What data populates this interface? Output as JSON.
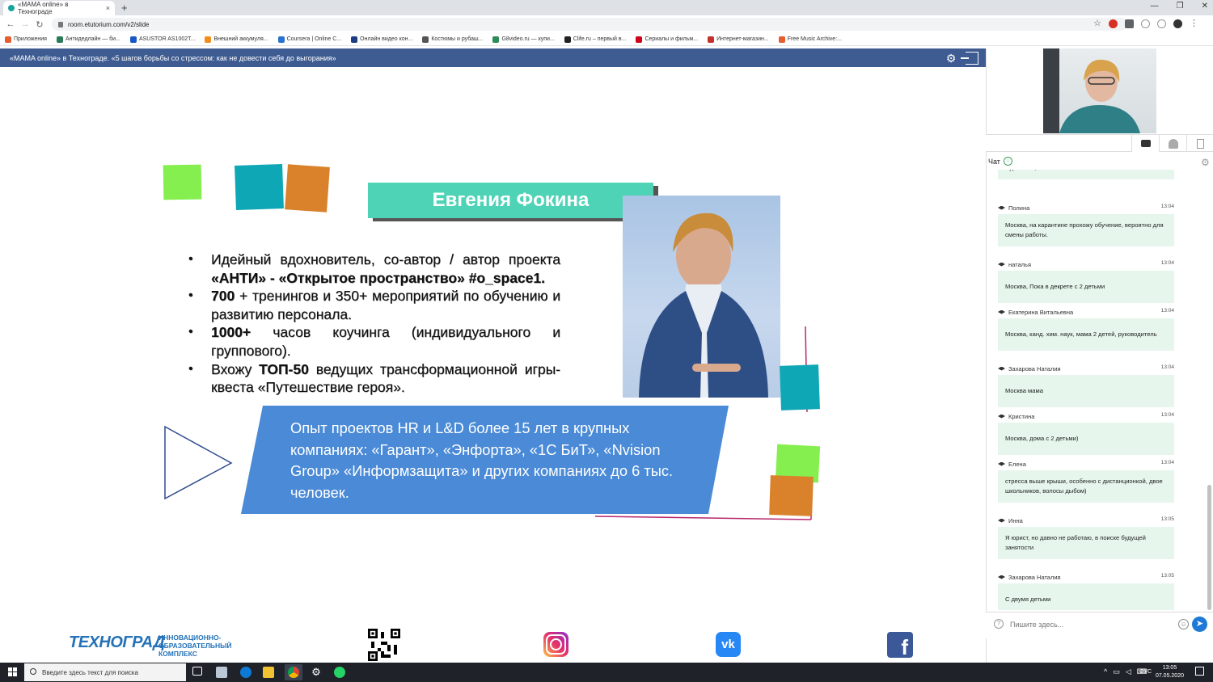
{
  "browser": {
    "tab_title": "«MAMA online» в Технограде",
    "tab_close": "×",
    "new_tab": "+",
    "url": "room.etutorium.com/v2/slide",
    "window_controls": [
      "—",
      "❐",
      "✕"
    ],
    "bookmarks": [
      {
        "label": "Приложения",
        "color": "#e65d2e"
      },
      {
        "label": "Антидедлайн — би...",
        "color": "#2b7a5a"
      },
      {
        "label": "ASUSTOR AS1002T...",
        "color": "#1a56c4"
      },
      {
        "label": "Внешний аккумуля...",
        "color": "#f28c1b"
      },
      {
        "label": "Coursera | Online C...",
        "color": "#2a73cc"
      },
      {
        "label": "Онлайн видео кон...",
        "color": "#1e3b86"
      },
      {
        "label": "Костюмы и рубаш...",
        "color": "#555555"
      },
      {
        "label": "G8video.ru — купи...",
        "color": "#2e8b57"
      },
      {
        "label": "Clife.ru – первый в...",
        "color": "#222222"
      },
      {
        "label": "Сериалы и фильм...",
        "color": "#d0021b"
      },
      {
        "label": "Интернет-магазин...",
        "color": "#c4302b"
      },
      {
        "label": "Free Music Archive:...",
        "color": "#e65d2e"
      }
    ]
  },
  "webinar": {
    "title": "«MAMA online» в Технограде. «5 шагов борьбы со стрессом: как не довести себя до выгорания»"
  },
  "slide": {
    "speaker_name": "Евгения Фокина",
    "bio": [
      {
        "pre": "Идейный вдохновитель, со-автор / автор проекта ",
        "bold": "«АНТИ» - «Открытое пространство» #o_space1.",
        "post": ""
      },
      {
        "pre": "",
        "bold": "700",
        "post": " + тренингов и 350+ мероприятий по обучению и развитию персонала."
      },
      {
        "pre": "",
        "bold": "1000+",
        "post": " часов коучинга (индивидуального и группового)."
      },
      {
        "pre": "Вхожу ",
        "bold": "ТОП-50",
        "post": " ведущих трансформационной игры-квеста «Путешествие героя»."
      }
    ],
    "experience": "Опыт проектов HR и L&D более 15 лет в крупных компаниях: «Гарант», «Энфорта», «1С БиТ», «Nvision Group» «Информзащита» и других компаниях до 6 тыс. человек.",
    "logo_name": "ТЕХНОГРАД",
    "logo_sub": [
      "ИННОВАЦИОННО-",
      "ОБРАЗОВАТЕЛЬНЫЙ",
      "КОМПЛЕКС"
    ],
    "colors": {
      "teal": "#4fd3b7",
      "blue": "#4a8ad6",
      "green": "#86ef50",
      "cyan": "#0ea7b5",
      "orange": "#d9822b",
      "magenta": "#b8266e"
    }
  },
  "panel": {
    "chat_label": "Чат",
    "input_placeholder": "Пишите здесь...",
    "messages": [
      {
        "name": "",
        "time": "",
        "text": "журналист, Рг. Москв"
      },
      {
        "name": "Полина",
        "time": "13:04",
        "text": "Москва, на карантине прохожу обучение, вероятно для смены работы."
      },
      {
        "name": "наталья",
        "time": "13:04",
        "text": "Москва, Пока в декрете с 2 детьми"
      },
      {
        "name": "Екатерина Витальевна",
        "time": "13:04",
        "text": "Москва, канд. хим. наук, мама 2 детей, руководитель"
      },
      {
        "name": "Захарова Наталия",
        "time": "13:04",
        "text": "Москва мама"
      },
      {
        "name": "Кристина",
        "time": "13:04",
        "text": "Москва, дома с 2 детьми)"
      },
      {
        "name": "Елена",
        "time": "13:04",
        "text": "стресса выше крыши, особенно с дистанционкой, двое школьников, волосы дыбом)"
      },
      {
        "name": "Инна",
        "time": "13:05",
        "text": "Я юрист, но давно не работаю, в поиске будущей занятости"
      },
      {
        "name": "Захарова Наталия",
        "time": "13:05",
        "text": "С двумя детьми"
      }
    ]
  },
  "taskbar": {
    "search_placeholder": "Введите здесь текст для поиска",
    "lang": "РУС",
    "time": "13:05",
    "date": "07.05.2020"
  }
}
